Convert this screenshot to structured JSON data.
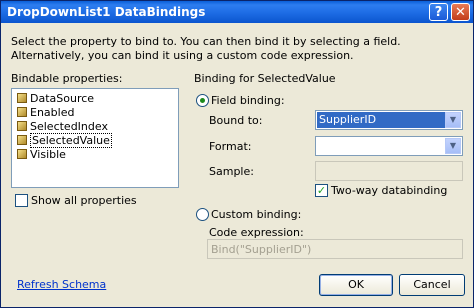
{
  "window": {
    "title": "DropDownList1 DataBindings"
  },
  "title_buttons": {
    "help": "?",
    "close": "✕"
  },
  "description": "Select the property to bind to. You can then bind it by selecting a field. Alternatively, you can bind it using a custom code expression.",
  "bindable": {
    "label": "Bindable properties:",
    "items": [
      {
        "label": "DataSource"
      },
      {
        "label": "Enabled"
      },
      {
        "label": "SelectedIndex"
      },
      {
        "label": "SelectedValue",
        "selected": true
      },
      {
        "label": "Visible"
      }
    ],
    "show_all_label": "Show all properties",
    "show_all_checked": false
  },
  "binding": {
    "group_label": "Binding for SelectedValue",
    "field_binding_label": "Field binding:",
    "field_binding_selected": true,
    "bound_to_label": "Bound to:",
    "bound_to_value": "SupplierID",
    "format_label": "Format:",
    "format_value": "",
    "sample_label": "Sample:",
    "sample_value": "",
    "two_way_label": "Two-way databinding",
    "two_way_checked": true,
    "custom_binding_label": "Custom binding:",
    "custom_binding_selected": false,
    "code_expression_label": "Code expression:",
    "code_expression_value": "Bind(\"SupplierID\")"
  },
  "footer": {
    "refresh_link": "Refresh Schema",
    "ok_label": "OK",
    "cancel_label": "Cancel"
  },
  "colors": {
    "titlebar": "#0a5fd8",
    "dialog_bg": "#ece9d8",
    "selection": "#316ac5",
    "link": "#0033cc"
  }
}
